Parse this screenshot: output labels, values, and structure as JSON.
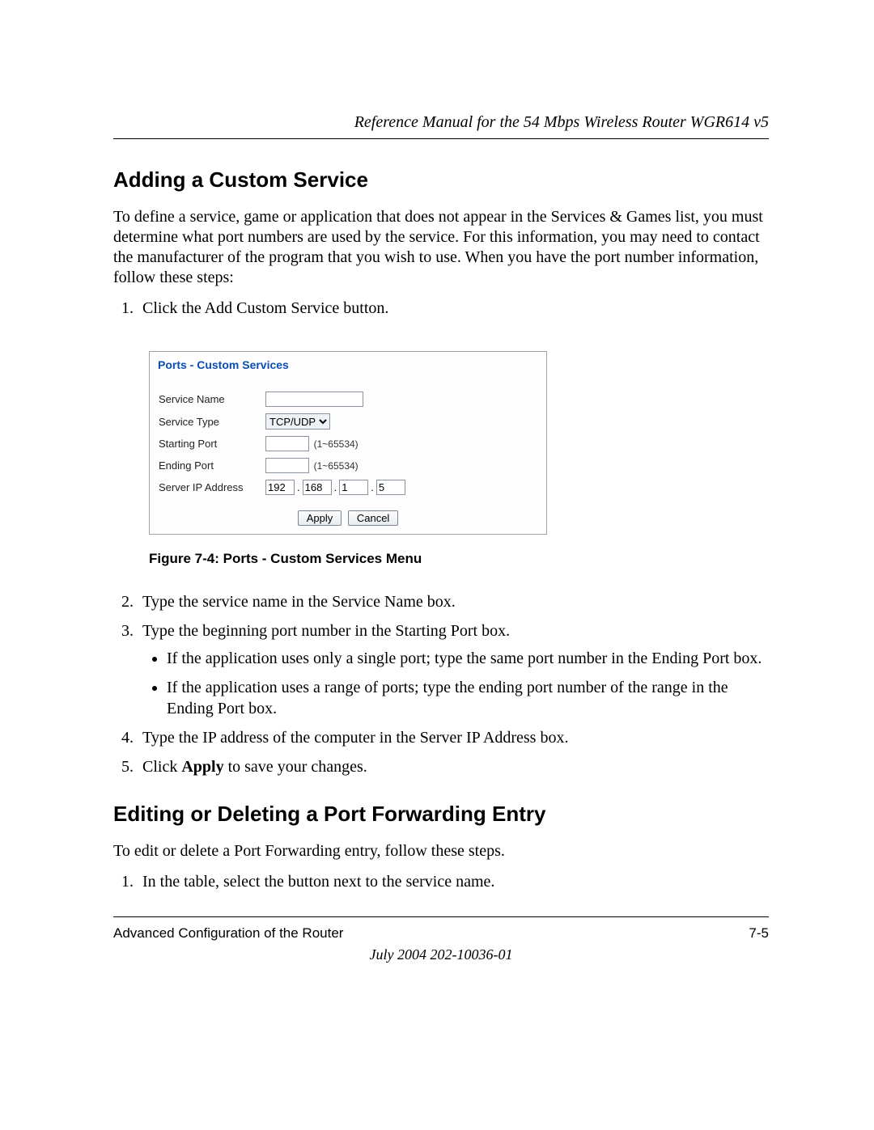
{
  "running_head": "Reference Manual for the 54 Mbps Wireless Router WGR614 v5",
  "section1": {
    "title": "Adding a Custom Service",
    "intro": "To define a service, game or application that does not appear in the Services & Games list, you must determine what port numbers are used by the service. For this information, you may need to contact the manufacturer of the program that you wish to use. When you have the port number information, follow these steps:",
    "step1": "Click the Add Custom Service button."
  },
  "panel": {
    "title": "Ports - Custom Services",
    "rows": {
      "service_name_label": "Service Name",
      "service_type_label": "Service Type",
      "starting_port_label": "Starting Port",
      "ending_port_label": "Ending Port",
      "server_ip_label": "Server IP Address"
    },
    "service_name_value": "",
    "service_type_value": "TCP/UDP",
    "starting_port_value": "",
    "ending_port_value": "",
    "port_range_hint": "(1~65534)",
    "ip": {
      "a": "192",
      "b": "168",
      "c": "1",
      "d": "5"
    },
    "buttons": {
      "apply": "Apply",
      "cancel": "Cancel"
    }
  },
  "figure_caption": "Figure 7-4:  Ports - Custom Services Menu",
  "steps_after": {
    "s2": "Type the service name in the Service Name box.",
    "s3": "Type the beginning port number in the Starting Port box.",
    "s3_b1": "If the application uses only a single port; type the same port number in the Ending Port box.",
    "s3_b2": "If the application uses a range of ports; type the ending port number of the range in the Ending Port box.",
    "s4": "Type the IP address of the computer in the Server IP Address box.",
    "s5_pre": "Click ",
    "s5_bold": "Apply",
    "s5_post": " to save your changes."
  },
  "section2": {
    "title": "Editing or Deleting a Port Forwarding Entry",
    "intro": "To edit or delete a Port Forwarding entry, follow these steps.",
    "step1": "In the table, select the button next to the service name."
  },
  "footer": {
    "left": "Advanced Configuration of the Router",
    "right": "7-5",
    "date": "July 2004 202-10036-01"
  }
}
